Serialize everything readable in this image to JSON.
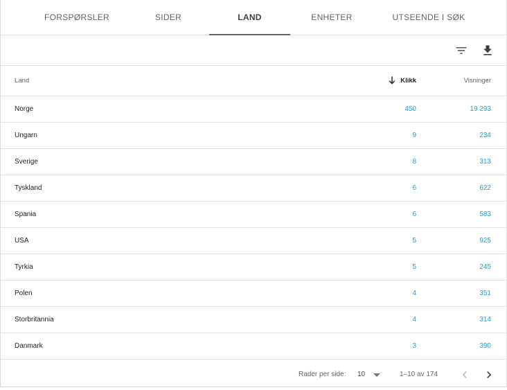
{
  "tabs": [
    {
      "label": "FORSPØRSLER",
      "active": false
    },
    {
      "label": "SIDER",
      "active": false
    },
    {
      "label": "LAND",
      "active": true
    },
    {
      "label": "ENHETER",
      "active": false
    },
    {
      "label": "UTSEENDE I SØK",
      "active": false
    }
  ],
  "toolbar": {
    "filter_icon": "filter-icon",
    "download_icon": "download-icon"
  },
  "table": {
    "columns": {
      "country": "Land",
      "clicks": "Klikk",
      "impressions": "Visninger"
    },
    "sort": {
      "column": "clicks",
      "direction": "descending",
      "icon": "arrow-down-icon"
    },
    "rows": [
      {
        "country": "Norge",
        "clicks": "450",
        "impressions": "19 293"
      },
      {
        "country": "Ungarn",
        "clicks": "9",
        "impressions": "234"
      },
      {
        "country": "Sverige",
        "clicks": "8",
        "impressions": "313"
      },
      {
        "country": "Tyskland",
        "clicks": "6",
        "impressions": "622"
      },
      {
        "country": "Spania",
        "clicks": "6",
        "impressions": "583"
      },
      {
        "country": "USA",
        "clicks": "5",
        "impressions": "925"
      },
      {
        "country": "Tyrkia",
        "clicks": "5",
        "impressions": "245"
      },
      {
        "country": "Polen",
        "clicks": "4",
        "impressions": "351"
      },
      {
        "country": "Storbritannia",
        "clicks": "4",
        "impressions": "314"
      },
      {
        "country": "Danmark",
        "clicks": "3",
        "impressions": "390"
      }
    ]
  },
  "footer": {
    "rows_per_page_label": "Rader per side:",
    "rows_per_page_value": "10",
    "range_text": "1–10 av 174",
    "prev_icon": "chevron-left-icon",
    "next_icon": "chevron-right-icon"
  },
  "colors": {
    "value_link": "#1a9fd8",
    "divider": "#e0e0e0",
    "disabled": "#bdbdbd"
  }
}
